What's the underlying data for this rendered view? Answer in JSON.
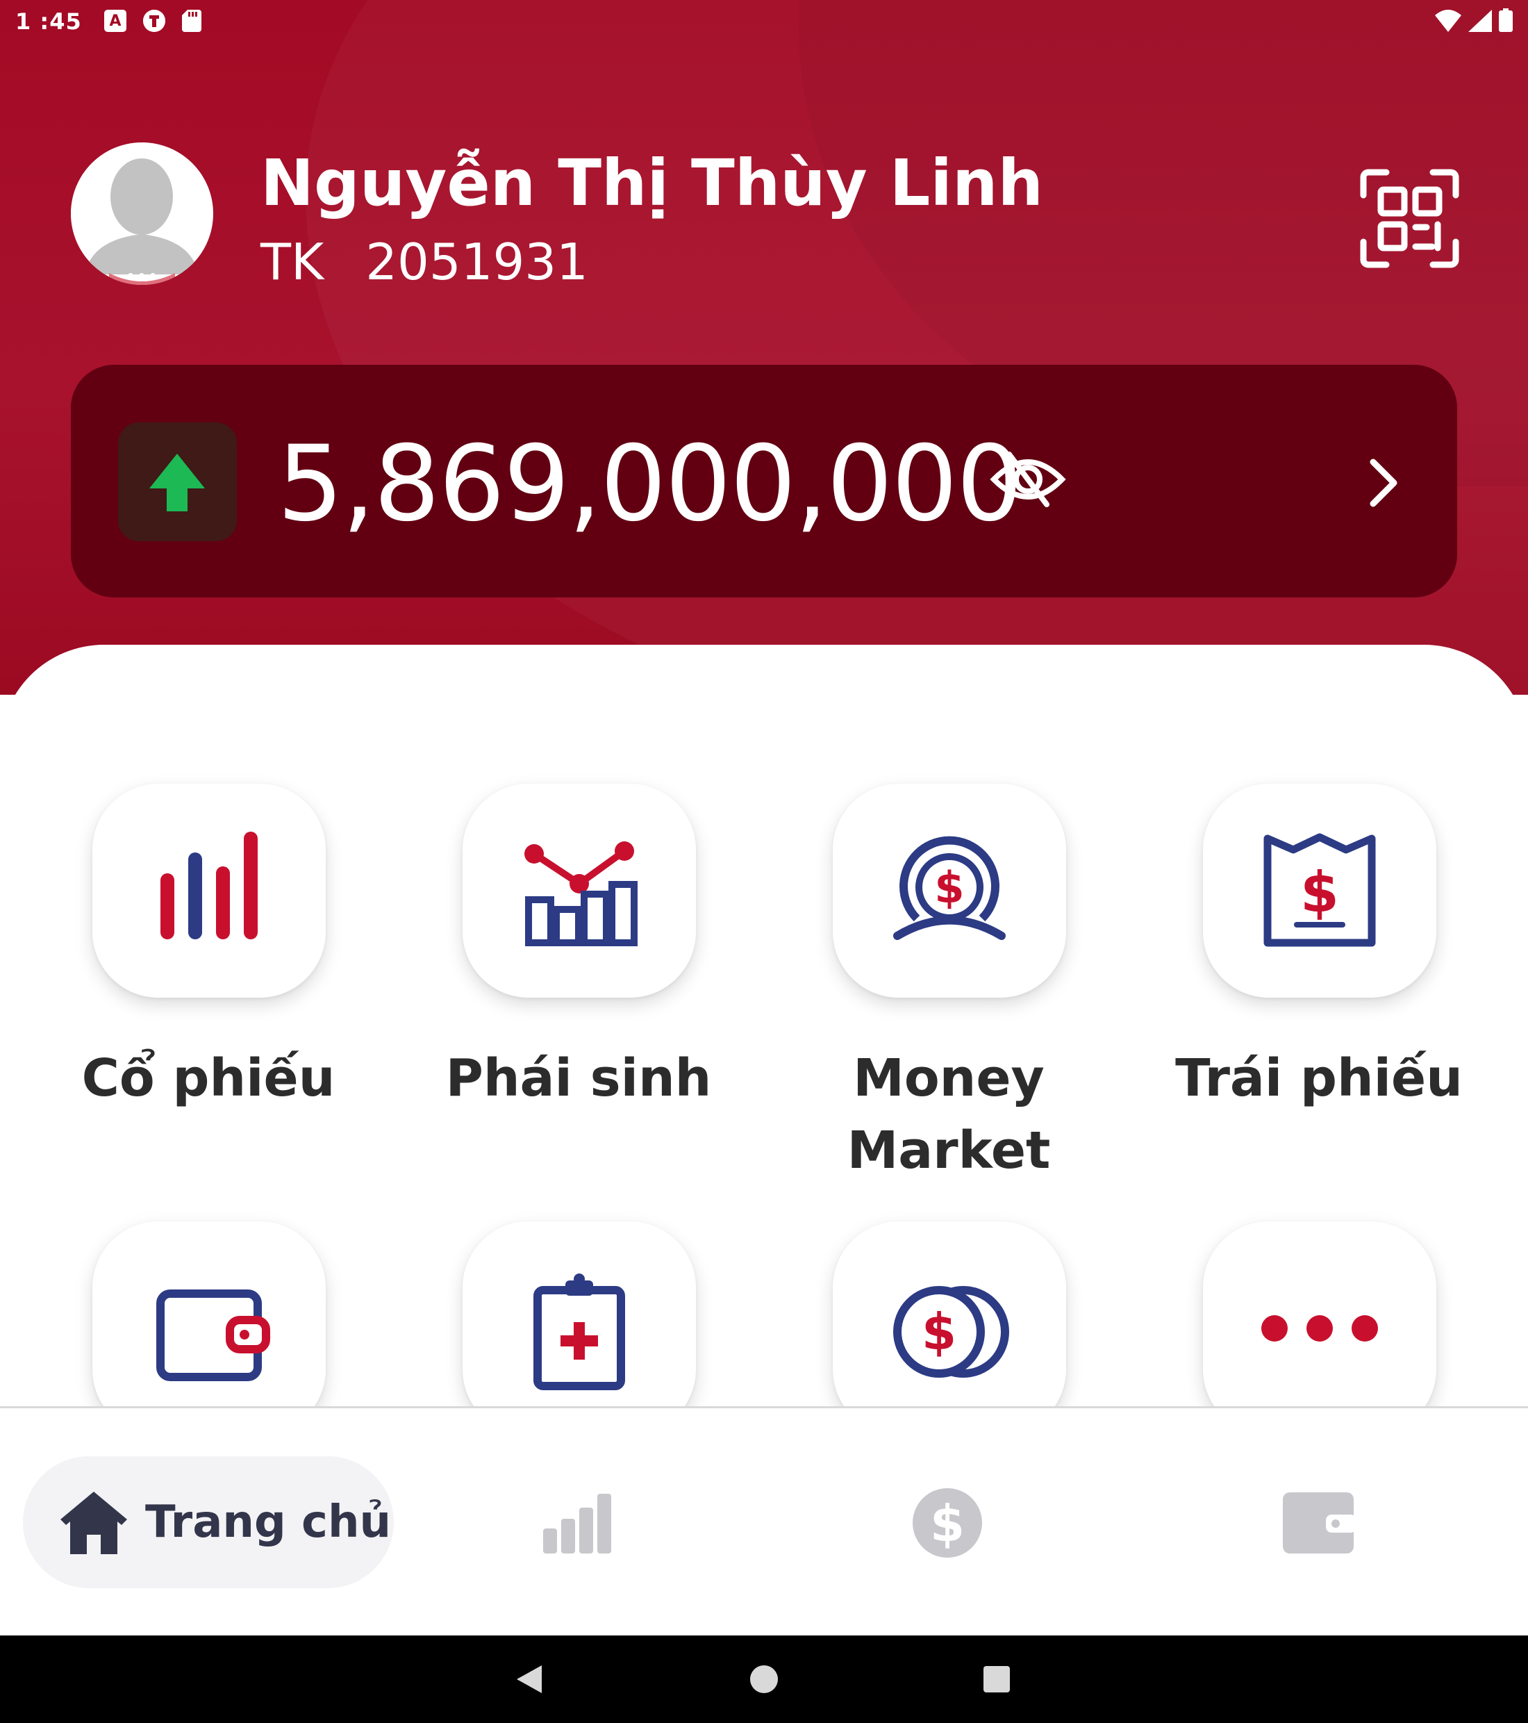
{
  "status_bar": {
    "time": "1 :45",
    "left_icons": [
      "a-badge-icon",
      "circle-t-icon",
      "sd-card-icon"
    ],
    "right_icons": [
      "wifi-icon",
      "signal-icon",
      "battery-icon"
    ],
    "a_badge": "A"
  },
  "profile": {
    "name": "Nguyễn Thị Thùy Linh",
    "account_prefix": "TK",
    "account_number": "2051931",
    "avatar_icon": "user-silhouette-icon",
    "qr_icon": "qr-scan-icon"
  },
  "balance": {
    "value": "5,869,000,000",
    "trend": "up",
    "trend_icon": "arrow-up-icon",
    "eye_icon": "eye-slash-icon",
    "chevron_icon": "chevron-right-icon"
  },
  "menu": {
    "items": [
      {
        "label": "Cổ phiếu",
        "icon": "stock-bars-icon"
      },
      {
        "label": "Phái sinh",
        "icon": "derivatives-chart-icon"
      },
      {
        "label": "Money Market",
        "icon": "money-market-icon"
      },
      {
        "label": "Trái phiếu",
        "icon": "bond-certificate-icon"
      },
      {
        "label": "",
        "icon": "wallet-icon"
      },
      {
        "label": "",
        "icon": "insurance-clipboard-icon"
      },
      {
        "label": "",
        "icon": "coins-icon"
      },
      {
        "label": "",
        "icon": "more-dots-icon"
      }
    ]
  },
  "bottom_nav": {
    "home_label": "Trang chủ",
    "items": [
      "home-icon",
      "market-bars-icon",
      "dollar-coin-icon",
      "wallet-icon"
    ]
  },
  "colors": {
    "brand_red": "#a30a25",
    "card_dark_red": "#620012",
    "icon_navy": "#2c3b84",
    "icon_red": "#c8102e",
    "trend_green": "#1db954",
    "nav_inactive": "#c7c7cc"
  }
}
